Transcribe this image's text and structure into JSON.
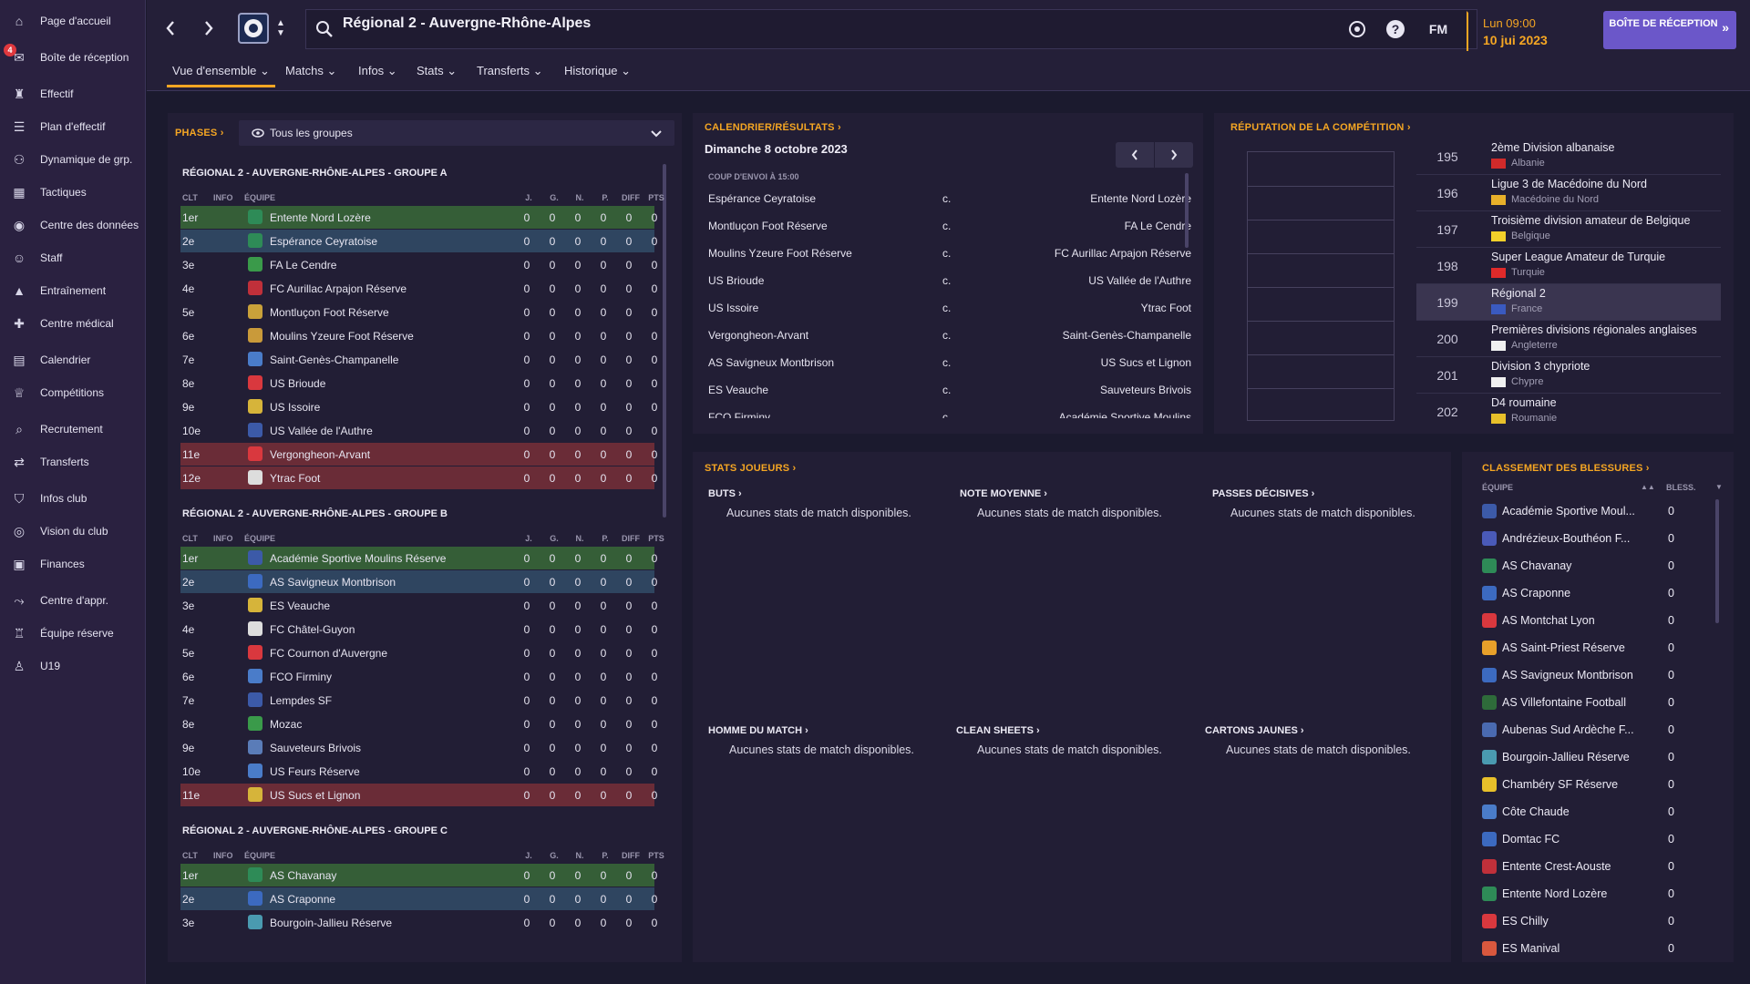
{
  "sidebar": {
    "items": [
      {
        "label": "Page d'accueil",
        "icon": "home-icon",
        "glyph": "⌂"
      },
      {
        "label": "Boîte de réception",
        "icon": "inbox-icon",
        "glyph": "✉",
        "badge": "4"
      },
      {
        "label": "Effectif",
        "icon": "squad-icon",
        "glyph": "♜"
      },
      {
        "label": "Plan d'effectif",
        "icon": "squad-plan-icon",
        "glyph": "☰"
      },
      {
        "label": "Dynamique de grp.",
        "icon": "group-dynamics-icon",
        "glyph": "⚇"
      },
      {
        "label": "Tactiques",
        "icon": "tactics-icon",
        "glyph": "▦"
      },
      {
        "label": "Centre des données",
        "icon": "data-hub-icon",
        "glyph": "◉"
      },
      {
        "label": "Staff",
        "icon": "staff-icon",
        "glyph": "☺"
      },
      {
        "label": "Entraînement",
        "icon": "training-icon",
        "glyph": "▲"
      },
      {
        "label": "Centre médical",
        "icon": "medical-icon",
        "glyph": "✚"
      },
      {
        "label": "Calendrier",
        "icon": "calendar-icon",
        "glyph": "▤"
      },
      {
        "label": "Compétitions",
        "icon": "trophy-icon",
        "glyph": "♕"
      },
      {
        "label": "Recrutement",
        "icon": "scouting-icon",
        "glyph": "⌕"
      },
      {
        "label": "Transferts",
        "icon": "transfers-icon",
        "glyph": "⇄"
      },
      {
        "label": "Infos club",
        "icon": "club-info-icon",
        "glyph": "⛉"
      },
      {
        "label": "Vision du club",
        "icon": "club-vision-icon",
        "glyph": "◎"
      },
      {
        "label": "Finances",
        "icon": "finances-icon",
        "glyph": "▣"
      },
      {
        "label": "Centre d'appr.",
        "icon": "academy-icon",
        "glyph": "⤳"
      },
      {
        "label": "Équipe réserve",
        "icon": "reserve-team-icon",
        "glyph": "♖"
      },
      {
        "label": "U19",
        "icon": "u19-icon",
        "glyph": "♙"
      }
    ]
  },
  "header": {
    "title": "Régional 2 - Auvergne-Rhône-Alpes",
    "time": "Lun 09:00",
    "date": "10 jui 2023",
    "fm_label": "FM",
    "inbox_button": "BOÎTE DE RÉCEPTION"
  },
  "tabs": [
    {
      "label": "Vue d'ensemble ⌄",
      "active": true
    },
    {
      "label": "Matchs ⌄"
    },
    {
      "label": "Infos ⌄"
    },
    {
      "label": "Stats ⌄"
    },
    {
      "label": "Transferts ⌄"
    },
    {
      "label": "Historique ⌄"
    }
  ],
  "standings": {
    "phases_label": "PHASES ›",
    "dropdown_value": "Tous les groupes",
    "columns": [
      "CLT",
      "INFO",
      "ÉQUIPE",
      "J.",
      "G.",
      "N.",
      "P.",
      "DIFF",
      "PTS"
    ],
    "groups": [
      {
        "title": "RÉGIONAL 2 - AUVERGNE-RHÔNE-ALPES - GROUPE A",
        "rows": [
          {
            "pos": "1er",
            "team": "Entente Nord Lozère",
            "hl": "green",
            "badge": "#2e8b57",
            "stats": [
              "0",
              "0",
              "0",
              "0",
              "0",
              "0"
            ]
          },
          {
            "pos": "2e",
            "team": "Espérance Ceyratoise",
            "hl": "blue",
            "badge": "#2e8b57",
            "stats": [
              "0",
              "0",
              "0",
              "0",
              "0",
              "0"
            ]
          },
          {
            "pos": "3e",
            "team": "FA Le Cendre",
            "hl": "plain",
            "badge": "#3a9a4a",
            "stats": [
              "0",
              "0",
              "0",
              "0",
              "0",
              "0"
            ]
          },
          {
            "pos": "4e",
            "team": "FC Aurillac Arpajon Réserve",
            "hl": "plain",
            "badge": "#c0303a",
            "stats": [
              "0",
              "0",
              "0",
              "0",
              "0",
              "0"
            ]
          },
          {
            "pos": "5e",
            "team": "Montluçon Foot Réserve",
            "hl": "plain",
            "badge": "#c9a13a",
            "stats": [
              "0",
              "0",
              "0",
              "0",
              "0",
              "0"
            ]
          },
          {
            "pos": "6e",
            "team": "Moulins Yzeure Foot Réserve",
            "hl": "plain",
            "badge": "#c99a3a",
            "stats": [
              "0",
              "0",
              "0",
              "0",
              "0",
              "0"
            ]
          },
          {
            "pos": "7e",
            "team": "Saint-Genès-Champanelle",
            "hl": "plain",
            "badge": "#4a7cc9",
            "stats": [
              "0",
              "0",
              "0",
              "0",
              "0",
              "0"
            ]
          },
          {
            "pos": "8e",
            "team": "US Brioude",
            "hl": "plain",
            "badge": "#d9383e",
            "stats": [
              "0",
              "0",
              "0",
              "0",
              "0",
              "0"
            ]
          },
          {
            "pos": "9e",
            "team": "US Issoire",
            "hl": "plain",
            "badge": "#d6b43a",
            "stats": [
              "0",
              "0",
              "0",
              "0",
              "0",
              "0"
            ]
          },
          {
            "pos": "10e",
            "team": "US Vallée de l'Authre",
            "hl": "plain",
            "badge": "#3c5aa8",
            "stats": [
              "0",
              "0",
              "0",
              "0",
              "0",
              "0"
            ]
          },
          {
            "pos": "11e",
            "team": "Vergongheon-Arvant",
            "hl": "red",
            "badge": "#d9383e",
            "stats": [
              "0",
              "0",
              "0",
              "0",
              "0",
              "0"
            ]
          },
          {
            "pos": "12e",
            "team": "Ytrac Foot",
            "hl": "red",
            "badge": "#dddddd",
            "stats": [
              "0",
              "0",
              "0",
              "0",
              "0",
              "0"
            ]
          }
        ]
      },
      {
        "title": "RÉGIONAL 2 - AUVERGNE-RHÔNE-ALPES - GROUPE B",
        "rows": [
          {
            "pos": "1er",
            "team": "Académie Sportive Moulins Réserve",
            "hl": "green",
            "badge": "#3c5aa8",
            "stats": [
              "0",
              "0",
              "0",
              "0",
              "0",
              "0"
            ]
          },
          {
            "pos": "2e",
            "team": "AS Savigneux Montbrison",
            "hl": "blue",
            "badge": "#3c6ac0",
            "stats": [
              "0",
              "0",
              "0",
              "0",
              "0",
              "0"
            ]
          },
          {
            "pos": "3e",
            "team": "ES Veauche",
            "hl": "plain",
            "badge": "#d6b43a",
            "stats": [
              "0",
              "0",
              "0",
              "0",
              "0",
              "0"
            ]
          },
          {
            "pos": "4e",
            "team": "FC Châtel-Guyon",
            "hl": "plain",
            "badge": "#dddddd",
            "stats": [
              "0",
              "0",
              "0",
              "0",
              "0",
              "0"
            ]
          },
          {
            "pos": "5e",
            "team": "FC Cournon d'Auvergne",
            "hl": "plain",
            "badge": "#d9383e",
            "stats": [
              "0",
              "0",
              "0",
              "0",
              "0",
              "0"
            ]
          },
          {
            "pos": "6e",
            "team": "FCO Firminy",
            "hl": "plain",
            "badge": "#4a7cc9",
            "stats": [
              "0",
              "0",
              "0",
              "0",
              "0",
              "0"
            ]
          },
          {
            "pos": "7e",
            "team": "Lempdes SF",
            "hl": "plain",
            "badge": "#3c5aa8",
            "stats": [
              "0",
              "0",
              "0",
              "0",
              "0",
              "0"
            ]
          },
          {
            "pos": "8e",
            "team": "Mozac",
            "hl": "plain",
            "badge": "#3a9a4a",
            "stats": [
              "0",
              "0",
              "0",
              "0",
              "0",
              "0"
            ]
          },
          {
            "pos": "9e",
            "team": "Sauveteurs Brivois",
            "hl": "plain",
            "badge": "#5a7cb8",
            "stats": [
              "0",
              "0",
              "0",
              "0",
              "0",
              "0"
            ]
          },
          {
            "pos": "10e",
            "team": "US Feurs Réserve",
            "hl": "plain",
            "badge": "#4a7cc9",
            "stats": [
              "0",
              "0",
              "0",
              "0",
              "0",
              "0"
            ]
          },
          {
            "pos": "11e",
            "team": "US Sucs et Lignon",
            "hl": "red",
            "badge": "#d6b43a",
            "stats": [
              "0",
              "0",
              "0",
              "0",
              "0",
              "0"
            ]
          }
        ]
      },
      {
        "title": "RÉGIONAL 2 - AUVERGNE-RHÔNE-ALPES - GROUPE C",
        "rows": [
          {
            "pos": "1er",
            "team": "AS Chavanay",
            "hl": "green",
            "badge": "#2e8b57",
            "stats": [
              "0",
              "0",
              "0",
              "0",
              "0",
              "0"
            ]
          },
          {
            "pos": "2e",
            "team": "AS Craponne",
            "hl": "blue",
            "badge": "#3c6ac0",
            "stats": [
              "0",
              "0",
              "0",
              "0",
              "0",
              "0"
            ]
          },
          {
            "pos": "3e",
            "team": "Bourgoin-Jallieu Réserve",
            "hl": "plain",
            "badge": "#4a9ab0",
            "stats": [
              "0",
              "0",
              "0",
              "0",
              "0",
              "0"
            ]
          }
        ]
      }
    ]
  },
  "fixtures": {
    "title": "CALENDRIER/RÉSULTATS ›",
    "date": "Dimanche 8 octobre 2023",
    "kickoff": "COUP D'ENVOI À 15:00",
    "matches": [
      {
        "home": "Espérance Ceyratoise",
        "vs": "c.",
        "away": "Entente Nord Lozère"
      },
      {
        "home": "Montluçon Foot Réserve",
        "vs": "c.",
        "away": "FA Le Cendre"
      },
      {
        "home": "Moulins Yzeure Foot Réserve",
        "vs": "c.",
        "away": "FC Aurillac Arpajon Réserve"
      },
      {
        "home": "US Brioude",
        "vs": "c.",
        "away": "US Vallée de l'Authre"
      },
      {
        "home": "US Issoire",
        "vs": "c.",
        "away": "Ytrac Foot"
      },
      {
        "home": "Vergongheon-Arvant",
        "vs": "c.",
        "away": "Saint-Genès-Champanelle"
      },
      {
        "home": "AS Savigneux Montbrison",
        "vs": "c.",
        "away": "US Sucs et Lignon"
      },
      {
        "home": "ES Veauche",
        "vs": "c.",
        "away": "Sauveteurs Brivois"
      },
      {
        "home": "FCO Firminy",
        "vs": "c.",
        "away": "Académie Sportive Moulins"
      }
    ]
  },
  "reputation": {
    "title": "RÉPUTATION DE LA COMPÉTITION ›",
    "rows": [
      {
        "rank": "195",
        "name": "2ème Division albanaise",
        "country": "Albanie",
        "flag": "#d02a2a"
      },
      {
        "rank": "196",
        "name": "Ligue 3 de Macédoine du Nord",
        "country": "Macédoine du Nord",
        "flag": "#e8b02a"
      },
      {
        "rank": "197",
        "name": "Troisième division amateur de Belgique",
        "country": "Belgique",
        "flag": "#f2d02a"
      },
      {
        "rank": "198",
        "name": "Super League Amateur de Turquie",
        "country": "Turquie",
        "flag": "#e02a2a"
      },
      {
        "rank": "199",
        "name": "Régional 2",
        "country": "France",
        "flag": "#3a5ac0",
        "selected": true
      },
      {
        "rank": "200",
        "name": "Premières divisions régionales anglaises",
        "country": "Angleterre",
        "flag": "#f0f0f0"
      },
      {
        "rank": "201",
        "name": "Division 3 chypriote",
        "country": "Chypre",
        "flag": "#f0f0f0"
      },
      {
        "rank": "202",
        "name": "D4 roumaine",
        "country": "Roumanie",
        "flag": "#e8c02a"
      }
    ]
  },
  "player_stats": {
    "title": "STATS JOUEURS ›",
    "cells": [
      {
        "title": "BUTS ›",
        "empty": "Aucunes stats de match disponibles."
      },
      {
        "title": "NOTE MOYENNE ›",
        "empty": "Aucunes stats de match disponibles."
      },
      {
        "title": "PASSES DÉCISIVES ›",
        "empty": "Aucunes stats de match disponibles."
      },
      {
        "title": "HOMME DU MATCH ›",
        "empty": "Aucunes stats de match disponibles."
      },
      {
        "title": "CLEAN SHEETS ›",
        "empty": "Aucunes stats de match disponibles."
      },
      {
        "title": "CARTONS JAUNES ›",
        "empty": "Aucunes stats de match disponibles."
      }
    ]
  },
  "injuries": {
    "title": "CLASSEMENT DES BLESSURES ›",
    "col_team": "ÉQUIPE",
    "col_count": "BLESS.",
    "rows": [
      {
        "team": "Académie Sportive Moul...",
        "count": "0",
        "badge": "#3c5aa8"
      },
      {
        "team": "Andrézieux-Bouthéon F...",
        "count": "0",
        "badge": "#4a5ab8"
      },
      {
        "team": "AS Chavanay",
        "count": "0",
        "badge": "#2e8b57"
      },
      {
        "team": "AS Craponne",
        "count": "0",
        "badge": "#3c6ac0"
      },
      {
        "team": "AS Montchat Lyon",
        "count": "0",
        "badge": "#d9383e"
      },
      {
        "team": "AS Saint-Priest Réserve",
        "count": "0",
        "badge": "#e8a02a"
      },
      {
        "team": "AS Savigneux Montbrison",
        "count": "0",
        "badge": "#3c6ac0"
      },
      {
        "team": "AS Villefontaine Football",
        "count": "0",
        "badge": "#2e6b3a"
      },
      {
        "team": "Aubenas Sud Ardèche F...",
        "count": "0",
        "badge": "#4a6ab0"
      },
      {
        "team": "Bourgoin-Jallieu Réserve",
        "count": "0",
        "badge": "#4a9ab0"
      },
      {
        "team": "Chambéry SF Réserve",
        "count": "0",
        "badge": "#e8c02a"
      },
      {
        "team": "Côte Chaude",
        "count": "0",
        "badge": "#4a7cc9"
      },
      {
        "team": "Domtac FC",
        "count": "0",
        "badge": "#3c6ac0"
      },
      {
        "team": "Entente Crest-Aouste",
        "count": "0",
        "badge": "#c0303a"
      },
      {
        "team": "Entente Nord Lozère",
        "count": "0",
        "badge": "#2e8b57"
      },
      {
        "team": "ES Chilly",
        "count": "0",
        "badge": "#d9383e"
      },
      {
        "team": "ES Manival",
        "count": "0",
        "badge": "#d9583e"
      }
    ]
  },
  "colors": {
    "accent": "#f5a623",
    "primary_button": "#6b57c9",
    "sidebar": "#2a2140",
    "panel": "#221e35",
    "row_green": "#355e37",
    "row_blue": "#2f4560",
    "row_red": "#6a2c37"
  }
}
